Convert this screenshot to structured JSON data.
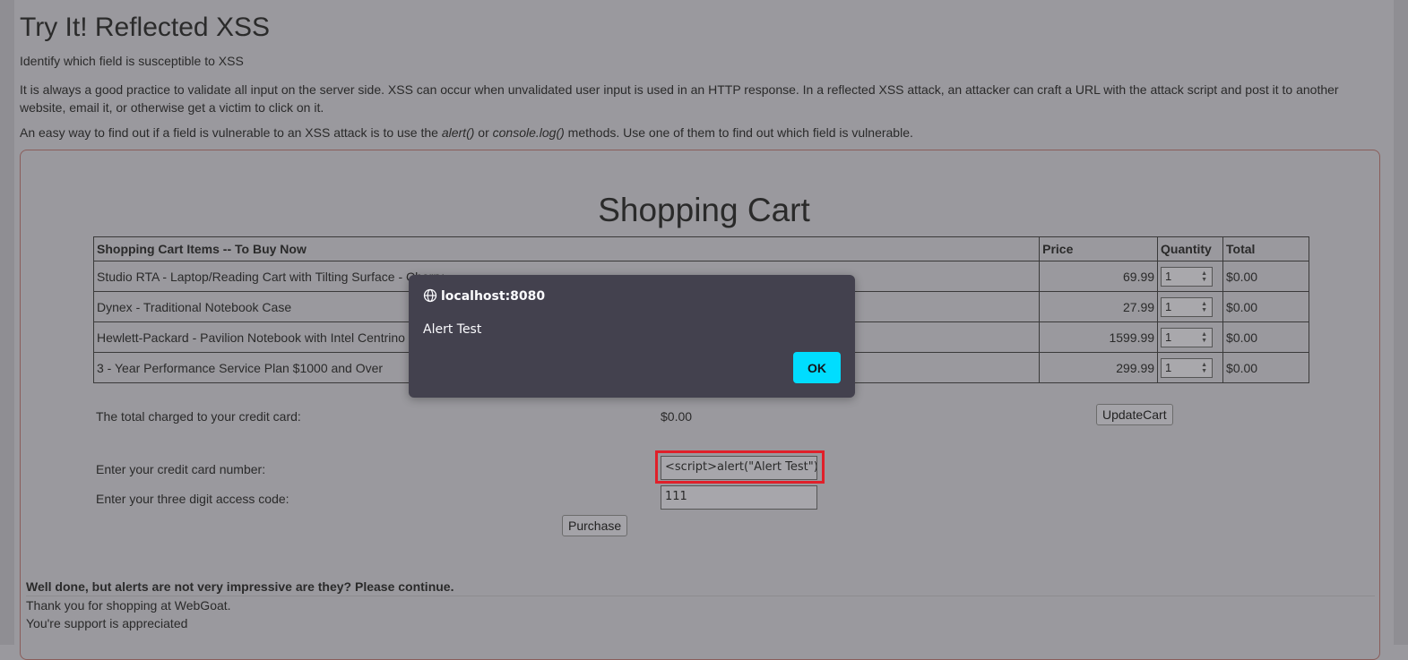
{
  "page": {
    "title": "Try It! Reflected XSS",
    "subtitle": "Identify which field is susceptible to XSS",
    "paragraph1": "It is always a good practice to validate all input on the server side. XSS can occur when unvalidated user input is used in an HTTP response. In a reflected XSS attack, an attacker can craft a URL with the attack script and post it to another website, email it, or otherwise get a victim to click on it.",
    "paragraph2_pre": "An easy way to find out if a field is vulnerable to an XSS attack is to use the ",
    "paragraph2_em1": "alert()",
    "paragraph2_mid": " or ",
    "paragraph2_em2": "console.log()",
    "paragraph2_post": " methods. Use one of them to find out which field is vulnerable."
  },
  "cart": {
    "title": "Shopping Cart",
    "headers": [
      "Shopping Cart Items -- To Buy Now",
      "Price",
      "Quantity",
      "Total"
    ],
    "rows": [
      {
        "item": "Studio RTA - Laptop/Reading Cart with Tilting Surface - Cherry",
        "price": "69.99",
        "qty": "1",
        "total": "$0.00"
      },
      {
        "item": "Dynex - Traditional Notebook Case",
        "price": "27.99",
        "qty": "1",
        "total": "$0.00"
      },
      {
        "item": "Hewlett-Packard - Pavilion Notebook with Intel Centrino",
        "price": "1599.99",
        "qty": "1",
        "total": "$0.00"
      },
      {
        "item": "3 - Year Performance Service Plan $1000 and Over",
        "price": "299.99",
        "qty": "1",
        "total": "$0.00"
      }
    ],
    "total_label": "The total charged to your credit card:",
    "total_value": "$0.00",
    "update_button": "UpdateCart",
    "cc_label": "Enter your credit card number:",
    "cc_value": "<script>alert(\"Alert Test\")</",
    "code_label": "Enter your three digit access code:",
    "code_value": "111",
    "purchase_button": "Purchase"
  },
  "feedback": {
    "bold": "Well done, but alerts are not very impressive are they? Please continue.",
    "line1": "Thank you for shopping at WebGoat.",
    "line2": "You're support is appreciated"
  },
  "dialog": {
    "origin": "localhost:8080",
    "message": "Alert Test",
    "ok_label": "OK"
  },
  "colors": {
    "dialog_bg": "#43414e",
    "ok_button": "#00ddff",
    "highlight": "#e0202a"
  }
}
